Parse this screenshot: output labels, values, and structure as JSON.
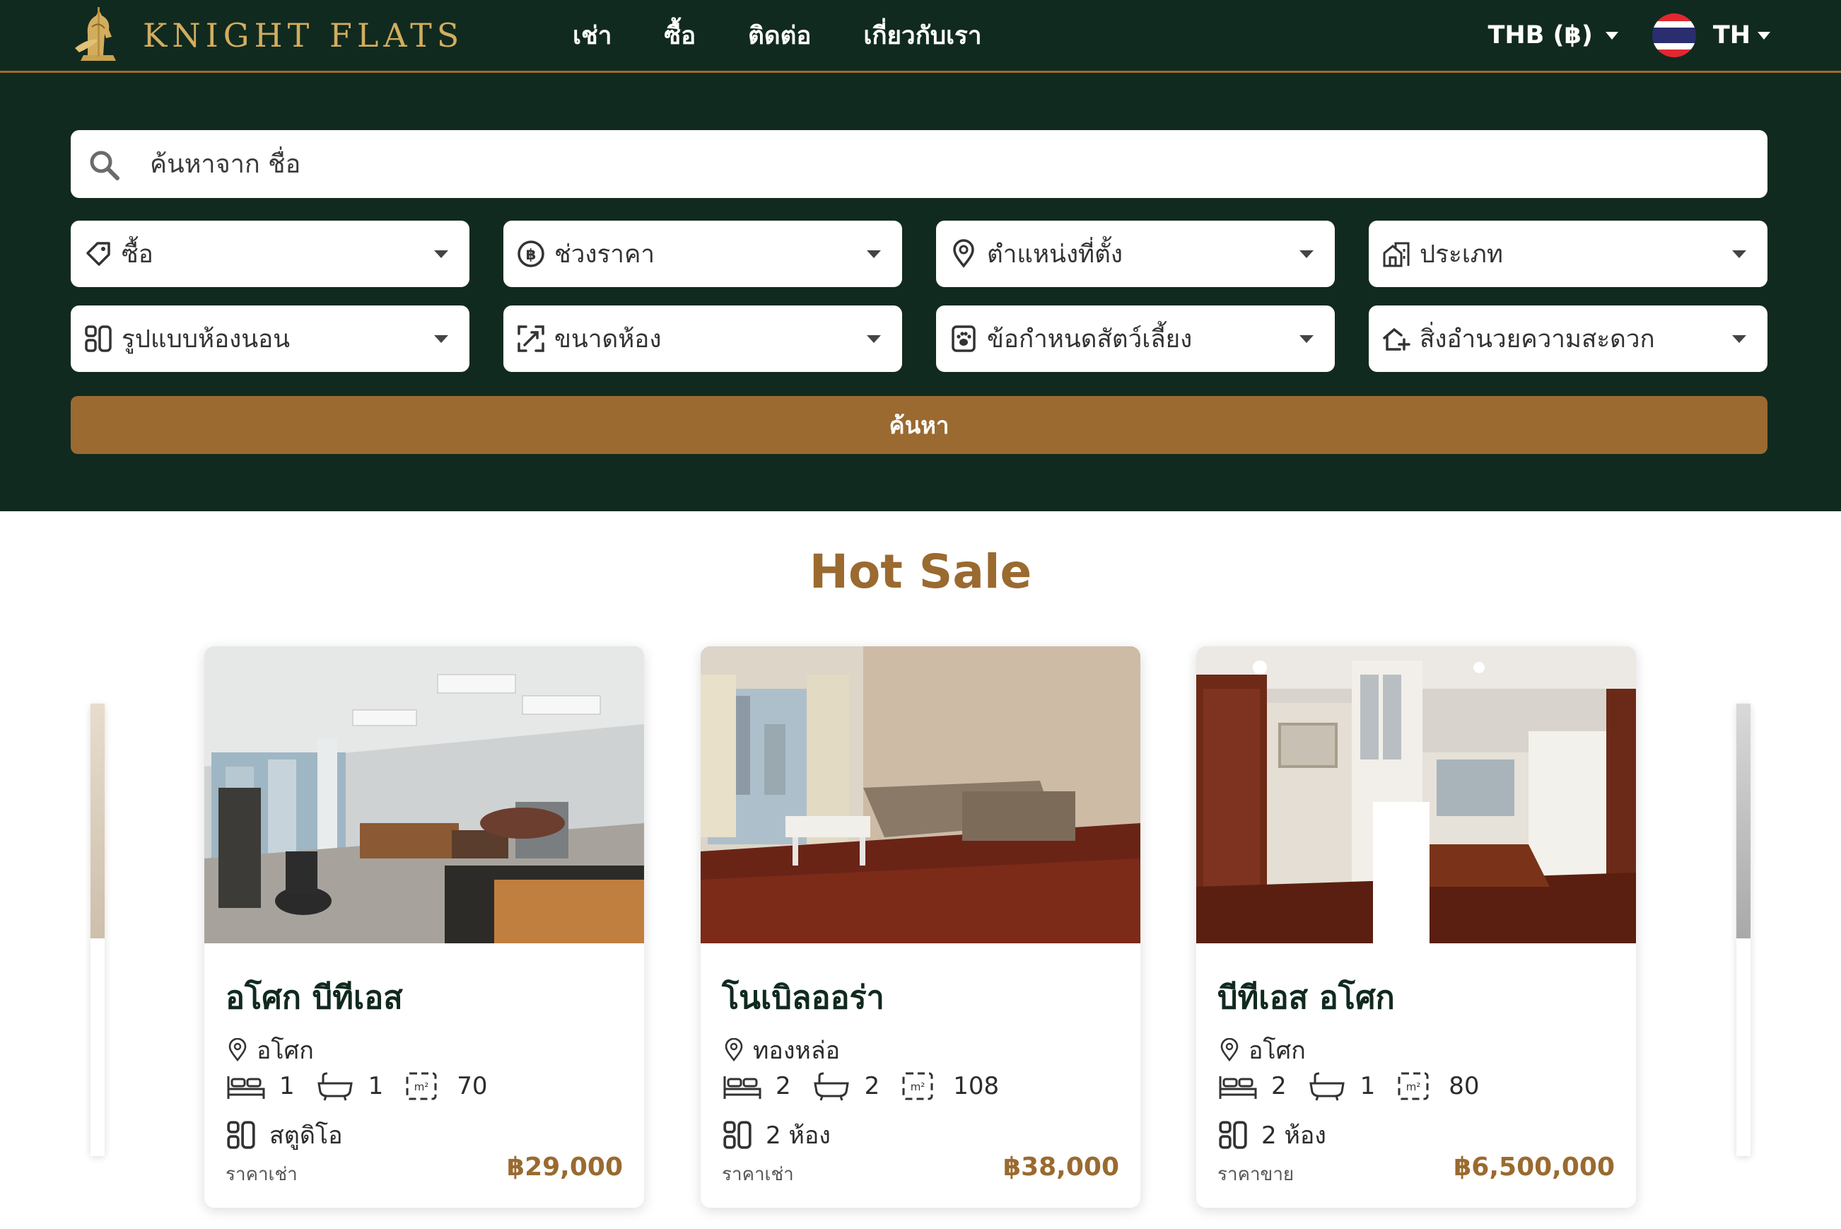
{
  "brand": {
    "name": "KNIGHT FLATS"
  },
  "nav": {
    "links": [
      "เช่า",
      "ซื้อ",
      "ติดต่อ",
      "เกี่ยวกับเรา"
    ],
    "currency": "THB (฿)",
    "language": "TH"
  },
  "search": {
    "placeholder": "ค้นหาจาก ชื่อ",
    "filters": [
      {
        "label": "ซื้อ",
        "icon": "tag-icon"
      },
      {
        "label": "ช่วงราคา",
        "icon": "baht-coin-icon"
      },
      {
        "label": "ตำแหน่งที่ตั้ง",
        "icon": "map-pin-icon"
      },
      {
        "label": "ประเภท",
        "icon": "building-icon"
      },
      {
        "label": "รูปแบบห้องนอน",
        "icon": "layout-icon"
      },
      {
        "label": "ขนาดห้อง",
        "icon": "expand-icon"
      },
      {
        "label": "ข้อกำหนดสัตว์เลี้ยง",
        "icon": "paw-icon"
      },
      {
        "label": "สิ่งอำนวยความสะดวก",
        "icon": "home-plus-icon"
      }
    ],
    "button_label": "ค้นหา"
  },
  "hot_sale": {
    "title": "Hot Sale",
    "listings": [
      {
        "name": "อโศก บีทีเอส",
        "location": "อโศก",
        "bedrooms": "1",
        "bathrooms": "1",
        "area": "70",
        "layout": "สตูดิโอ",
        "price_label": "ราคาเช่า",
        "price": "฿29,000"
      },
      {
        "name": "โนเบิลออร่า",
        "location": "ทองหล่อ",
        "bedrooms": "2",
        "bathrooms": "2",
        "area": "108",
        "layout": "2 ห้อง",
        "price_label": "ราคาเช่า",
        "price": "฿38,000"
      },
      {
        "name": "บีทีเอส อโศก",
        "location": "อโศก",
        "bedrooms": "2",
        "bathrooms": "1",
        "area": "80",
        "layout": "2 ห้อง",
        "price_label": "ราคาขาย",
        "price": "฿6,500,000"
      }
    ]
  },
  "colors": {
    "nav_bg": "#112a1f",
    "accent_gold": "#9a6a30",
    "logo_gold": "#d2ad5e",
    "title_green": "#112a1f"
  }
}
